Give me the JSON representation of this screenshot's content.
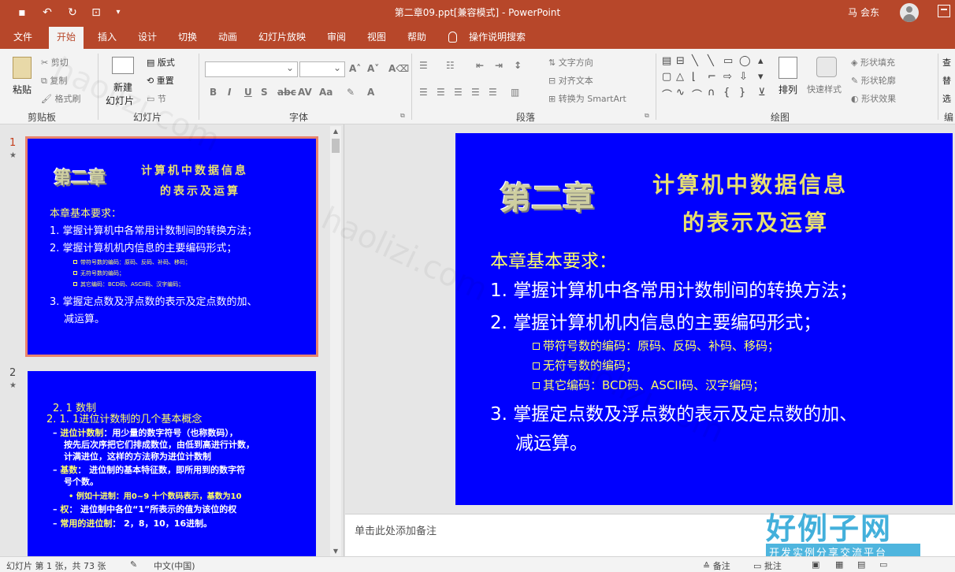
{
  "titlebar": {
    "doc_title": "第二章09.ppt[兼容模式]  -  PowerPoint",
    "user_name": "马 会东"
  },
  "menu": {
    "tabs": [
      "文件",
      "开始",
      "插入",
      "设计",
      "切换",
      "动画",
      "幻灯片放映",
      "审阅",
      "视图",
      "帮助"
    ],
    "tell_me": "操作说明搜索"
  },
  "ribbon": {
    "clipboard": {
      "paste": "粘贴",
      "cut": "剪切",
      "copy": "复制",
      "format_painter": "格式刷",
      "label": "剪贴板"
    },
    "slides": {
      "new_slide_1": "新建",
      "new_slide_2": "幻灯片",
      "layout": "版式",
      "reset": "重置",
      "section": "节",
      "label": "幻灯片"
    },
    "font": {
      "label": "字体",
      "font_name_value": "",
      "font_size_value": ""
    },
    "paragraph": {
      "text_direction": "文字方向",
      "align_text": "对齐文本",
      "smartart": "转换为 SmartArt",
      "label": "段落"
    },
    "drawing": {
      "arrange": "排列",
      "quick_styles": "快速样式",
      "shape_fill": "形状填充",
      "shape_outline": "形状轮廓",
      "shape_effects": "形状效果",
      "label": "绘图"
    },
    "editing": {
      "find": "查",
      "replace": "替",
      "select": "选",
      "label": "编"
    }
  },
  "thumbnails": {
    "slide1": {
      "number": "1",
      "chapter": "第二章",
      "title_line1": "计算机中数据信息",
      "title_line2": "的表示及运算",
      "req_heading": "本章基本要求：",
      "item1": "1. 掌握计算机中各常用计数制间的转换方法；",
      "item2": "2. 掌握计算机机内信息的主要编码形式；",
      "sub1": "带符号数的编码：原码、反码、补码、移码；",
      "sub2": "无符号数的编码；",
      "sub3": "其它编码：BCD码、ASCII码、汉字编码；",
      "item3_line1": "3. 掌握定点数及浮点数的表示及定点数的加、",
      "item3_line2": "减运算。"
    },
    "slide2": {
      "number": "2",
      "heading": "2. 1   数制",
      "subheading": "2. 1. 1进位计数制的几个基本概念",
      "p1_label": "进位计数制",
      "p1_line1": "：用少量的数字符号（也称数码），",
      "p1_line2": "按先后次序把它们排成数位，由低到高进行计数，",
      "p1_line3": "计满进位，这样的方法称为进位计数制",
      "p2_label": "基数",
      "p2_line1": "：   进位制的基本特征数，即所用到的数字符",
      "p2_line2": "号个数。",
      "p3": "• 例如十进制：用0~9 十个数码表示，基数为10",
      "p4_label": "权",
      "p4_text": "：    进位制中各位“1”所表示的值为该位的权",
      "p5_label": "常用的进位制",
      "p5_text": "：  2，8，10，16进制。"
    }
  },
  "main_slide": {
    "chapter": "第二章",
    "title_line1": "计算机中数据信息",
    "title_line2": "的表示及运算",
    "req_heading": "本章基本要求：",
    "item1": "1. 掌握计算机中各常用计数制间的转换方法；",
    "item2": "2. 掌握计算机机内信息的主要编码形式；",
    "sub1": "带符号数的编码：原码、反码、补码、移码；",
    "sub2": "无符号数的编码；",
    "sub3": "其它编码：BCD码、ASCII码、汉字编码；",
    "item3_line1": "3. 掌握定点数及浮点数的表示及定点数的加、",
    "item3_line2": "减运算。"
  },
  "notes": {
    "placeholder": "单击此处添加备注"
  },
  "status": {
    "slide_info": "幻灯片 第 1 张，共 73 张",
    "language": "中文(中国)",
    "notes_button": "备注",
    "comments_button": "批注"
  },
  "watermark": {
    "big": "好例子网",
    "small": "开发实例分享交流平台",
    "url": "haolizi.com"
  }
}
